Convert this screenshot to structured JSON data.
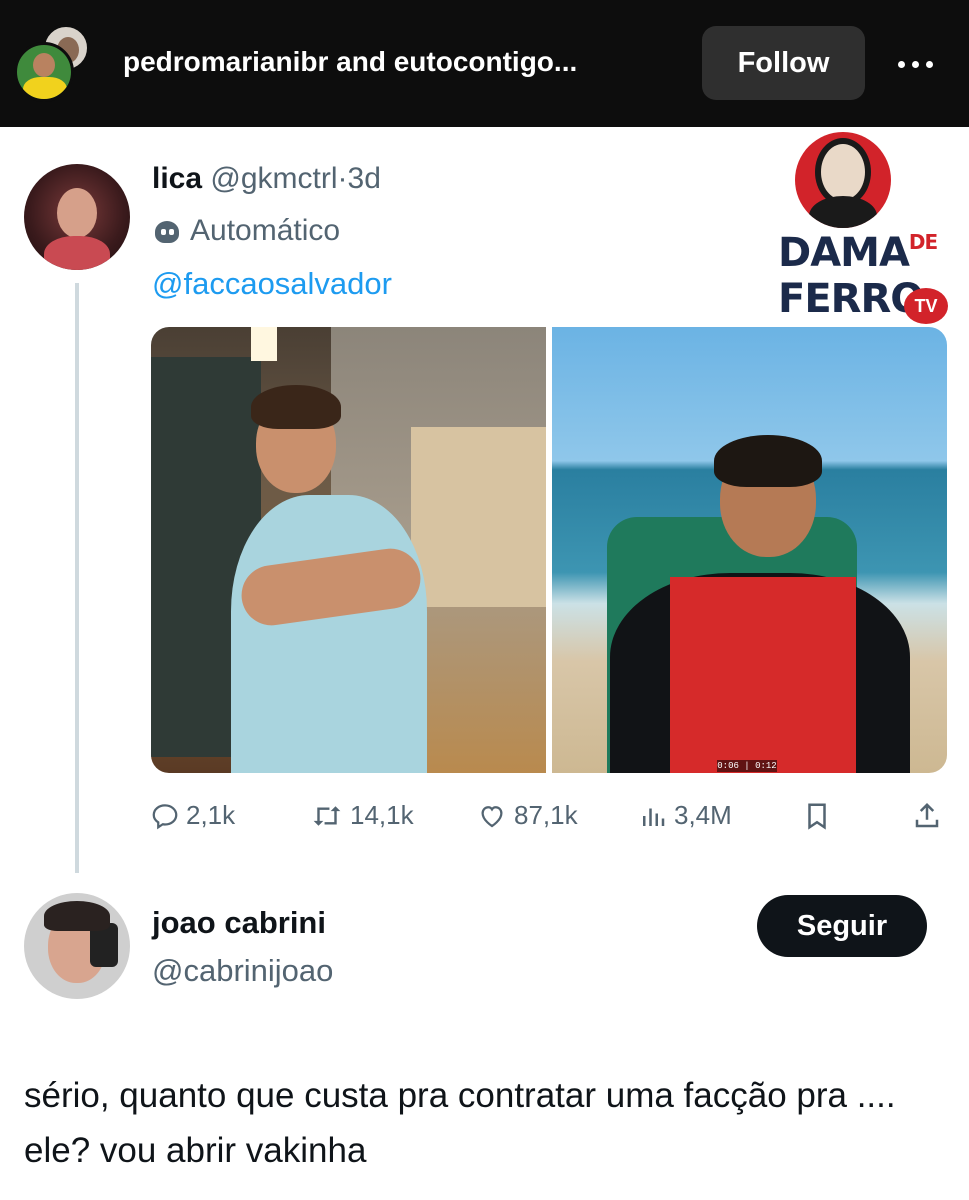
{
  "post_header": {
    "names": "pedromarianibr and eutocontigo...",
    "follow_label": "Follow"
  },
  "tweet": {
    "name": "lica",
    "handle": "@gkmctrl",
    "separator": "·",
    "time": "3d",
    "automated_label": "Automático",
    "mention": "@faccaosalvador",
    "video_timestamp": "0:06 | 0:12",
    "stats": {
      "replies": "2,1k",
      "retweets": "14,1k",
      "likes": "87,1k",
      "views": "3,4M"
    }
  },
  "watermark": {
    "line1": "DAMA",
    "de": "DE",
    "line2": "FERRO",
    "tv": "TV"
  },
  "reply": {
    "name": "joao cabrini",
    "handle": "@cabrinijoao",
    "follow_label": "Seguir",
    "text": "sério, quanto que custa pra contratar uma facção pra .... ele? vou abrir vakinha"
  },
  "colors": {
    "topbar_bg": "#0d0d0d",
    "link_blue": "#1d9bf0",
    "muted_text": "#536471",
    "primary_text": "#0f1419",
    "logo_red": "#d2232a",
    "logo_navy": "#1b2a4a"
  },
  "icons": {
    "more": "more-horizontal-icon",
    "bot": "bot-icon",
    "reply": "reply-icon",
    "retweet": "retweet-icon",
    "like": "heart-icon",
    "views": "views-chart-icon",
    "bookmark": "bookmark-icon",
    "share": "share-icon"
  }
}
